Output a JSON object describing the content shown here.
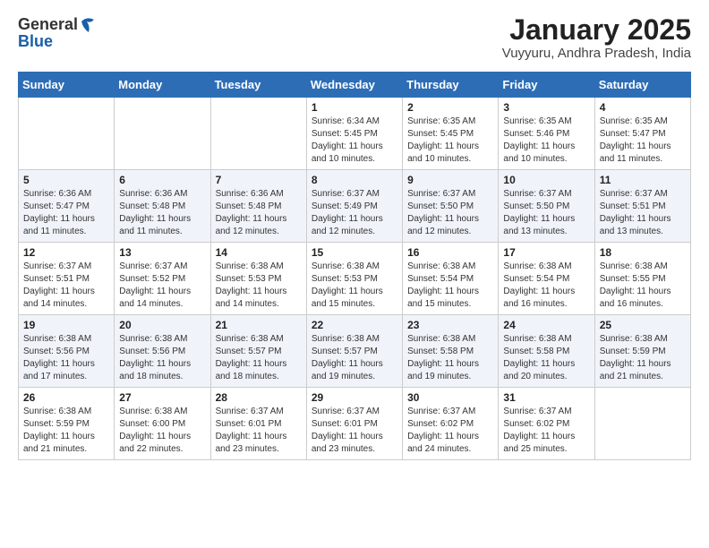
{
  "header": {
    "logo_line1": "General",
    "logo_line2": "Blue",
    "title": "January 2025",
    "subtitle": "Vuyyuru, Andhra Pradesh, India"
  },
  "days_of_week": [
    "Sunday",
    "Monday",
    "Tuesday",
    "Wednesday",
    "Thursday",
    "Friday",
    "Saturday"
  ],
  "weeks": [
    [
      {
        "day": "",
        "info": ""
      },
      {
        "day": "",
        "info": ""
      },
      {
        "day": "",
        "info": ""
      },
      {
        "day": "1",
        "info": "Sunrise: 6:34 AM\nSunset: 5:45 PM\nDaylight: 11 hours\nand 10 minutes."
      },
      {
        "day": "2",
        "info": "Sunrise: 6:35 AM\nSunset: 5:45 PM\nDaylight: 11 hours\nand 10 minutes."
      },
      {
        "day": "3",
        "info": "Sunrise: 6:35 AM\nSunset: 5:46 PM\nDaylight: 11 hours\nand 10 minutes."
      },
      {
        "day": "4",
        "info": "Sunrise: 6:35 AM\nSunset: 5:47 PM\nDaylight: 11 hours\nand 11 minutes."
      }
    ],
    [
      {
        "day": "5",
        "info": "Sunrise: 6:36 AM\nSunset: 5:47 PM\nDaylight: 11 hours\nand 11 minutes."
      },
      {
        "day": "6",
        "info": "Sunrise: 6:36 AM\nSunset: 5:48 PM\nDaylight: 11 hours\nand 11 minutes."
      },
      {
        "day": "7",
        "info": "Sunrise: 6:36 AM\nSunset: 5:48 PM\nDaylight: 11 hours\nand 12 minutes."
      },
      {
        "day": "8",
        "info": "Sunrise: 6:37 AM\nSunset: 5:49 PM\nDaylight: 11 hours\nand 12 minutes."
      },
      {
        "day": "9",
        "info": "Sunrise: 6:37 AM\nSunset: 5:50 PM\nDaylight: 11 hours\nand 12 minutes."
      },
      {
        "day": "10",
        "info": "Sunrise: 6:37 AM\nSunset: 5:50 PM\nDaylight: 11 hours\nand 13 minutes."
      },
      {
        "day": "11",
        "info": "Sunrise: 6:37 AM\nSunset: 5:51 PM\nDaylight: 11 hours\nand 13 minutes."
      }
    ],
    [
      {
        "day": "12",
        "info": "Sunrise: 6:37 AM\nSunset: 5:51 PM\nDaylight: 11 hours\nand 14 minutes."
      },
      {
        "day": "13",
        "info": "Sunrise: 6:37 AM\nSunset: 5:52 PM\nDaylight: 11 hours\nand 14 minutes."
      },
      {
        "day": "14",
        "info": "Sunrise: 6:38 AM\nSunset: 5:53 PM\nDaylight: 11 hours\nand 14 minutes."
      },
      {
        "day": "15",
        "info": "Sunrise: 6:38 AM\nSunset: 5:53 PM\nDaylight: 11 hours\nand 15 minutes."
      },
      {
        "day": "16",
        "info": "Sunrise: 6:38 AM\nSunset: 5:54 PM\nDaylight: 11 hours\nand 15 minutes."
      },
      {
        "day": "17",
        "info": "Sunrise: 6:38 AM\nSunset: 5:54 PM\nDaylight: 11 hours\nand 16 minutes."
      },
      {
        "day": "18",
        "info": "Sunrise: 6:38 AM\nSunset: 5:55 PM\nDaylight: 11 hours\nand 16 minutes."
      }
    ],
    [
      {
        "day": "19",
        "info": "Sunrise: 6:38 AM\nSunset: 5:56 PM\nDaylight: 11 hours\nand 17 minutes."
      },
      {
        "day": "20",
        "info": "Sunrise: 6:38 AM\nSunset: 5:56 PM\nDaylight: 11 hours\nand 18 minutes."
      },
      {
        "day": "21",
        "info": "Sunrise: 6:38 AM\nSunset: 5:57 PM\nDaylight: 11 hours\nand 18 minutes."
      },
      {
        "day": "22",
        "info": "Sunrise: 6:38 AM\nSunset: 5:57 PM\nDaylight: 11 hours\nand 19 minutes."
      },
      {
        "day": "23",
        "info": "Sunrise: 6:38 AM\nSunset: 5:58 PM\nDaylight: 11 hours\nand 19 minutes."
      },
      {
        "day": "24",
        "info": "Sunrise: 6:38 AM\nSunset: 5:58 PM\nDaylight: 11 hours\nand 20 minutes."
      },
      {
        "day": "25",
        "info": "Sunrise: 6:38 AM\nSunset: 5:59 PM\nDaylight: 11 hours\nand 21 minutes."
      }
    ],
    [
      {
        "day": "26",
        "info": "Sunrise: 6:38 AM\nSunset: 5:59 PM\nDaylight: 11 hours\nand 21 minutes."
      },
      {
        "day": "27",
        "info": "Sunrise: 6:38 AM\nSunset: 6:00 PM\nDaylight: 11 hours\nand 22 minutes."
      },
      {
        "day": "28",
        "info": "Sunrise: 6:37 AM\nSunset: 6:01 PM\nDaylight: 11 hours\nand 23 minutes."
      },
      {
        "day": "29",
        "info": "Sunrise: 6:37 AM\nSunset: 6:01 PM\nDaylight: 11 hours\nand 23 minutes."
      },
      {
        "day": "30",
        "info": "Sunrise: 6:37 AM\nSunset: 6:02 PM\nDaylight: 11 hours\nand 24 minutes."
      },
      {
        "day": "31",
        "info": "Sunrise: 6:37 AM\nSunset: 6:02 PM\nDaylight: 11 hours\nand 25 minutes."
      },
      {
        "day": "",
        "info": ""
      }
    ]
  ]
}
